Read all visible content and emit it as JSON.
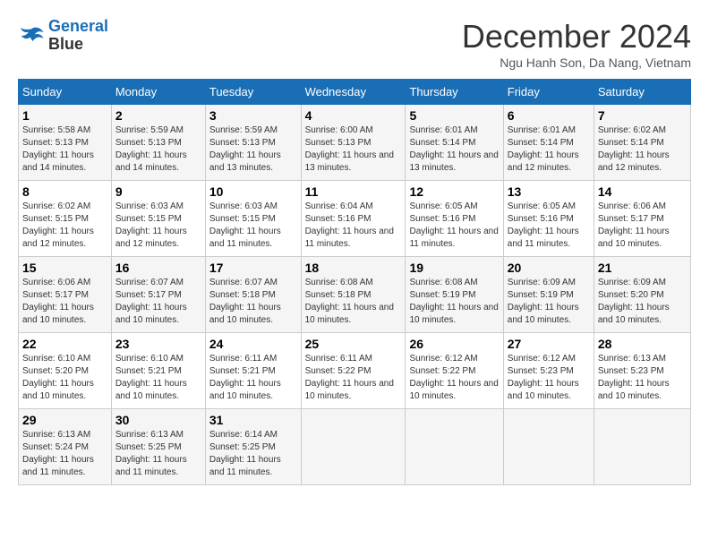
{
  "logo": {
    "line1": "General",
    "line2": "Blue"
  },
  "title": "December 2024",
  "location": "Ngu Hanh Son, Da Nang, Vietnam",
  "weekdays": [
    "Sunday",
    "Monday",
    "Tuesday",
    "Wednesday",
    "Thursday",
    "Friday",
    "Saturday"
  ],
  "weeks": [
    [
      {
        "day": "1",
        "sunrise": "5:58 AM",
        "sunset": "5:13 PM",
        "daylight": "11 hours and 14 minutes."
      },
      {
        "day": "2",
        "sunrise": "5:59 AM",
        "sunset": "5:13 PM",
        "daylight": "11 hours and 14 minutes."
      },
      {
        "day": "3",
        "sunrise": "5:59 AM",
        "sunset": "5:13 PM",
        "daylight": "11 hours and 13 minutes."
      },
      {
        "day": "4",
        "sunrise": "6:00 AM",
        "sunset": "5:13 PM",
        "daylight": "11 hours and 13 minutes."
      },
      {
        "day": "5",
        "sunrise": "6:01 AM",
        "sunset": "5:14 PM",
        "daylight": "11 hours and 13 minutes."
      },
      {
        "day": "6",
        "sunrise": "6:01 AM",
        "sunset": "5:14 PM",
        "daylight": "11 hours and 12 minutes."
      },
      {
        "day": "7",
        "sunrise": "6:02 AM",
        "sunset": "5:14 PM",
        "daylight": "11 hours and 12 minutes."
      }
    ],
    [
      {
        "day": "8",
        "sunrise": "6:02 AM",
        "sunset": "5:15 PM",
        "daylight": "11 hours and 12 minutes."
      },
      {
        "day": "9",
        "sunrise": "6:03 AM",
        "sunset": "5:15 PM",
        "daylight": "11 hours and 12 minutes."
      },
      {
        "day": "10",
        "sunrise": "6:03 AM",
        "sunset": "5:15 PM",
        "daylight": "11 hours and 11 minutes."
      },
      {
        "day": "11",
        "sunrise": "6:04 AM",
        "sunset": "5:16 PM",
        "daylight": "11 hours and 11 minutes."
      },
      {
        "day": "12",
        "sunrise": "6:05 AM",
        "sunset": "5:16 PM",
        "daylight": "11 hours and 11 minutes."
      },
      {
        "day": "13",
        "sunrise": "6:05 AM",
        "sunset": "5:16 PM",
        "daylight": "11 hours and 11 minutes."
      },
      {
        "day": "14",
        "sunrise": "6:06 AM",
        "sunset": "5:17 PM",
        "daylight": "11 hours and 10 minutes."
      }
    ],
    [
      {
        "day": "15",
        "sunrise": "6:06 AM",
        "sunset": "5:17 PM",
        "daylight": "11 hours and 10 minutes."
      },
      {
        "day": "16",
        "sunrise": "6:07 AM",
        "sunset": "5:17 PM",
        "daylight": "11 hours and 10 minutes."
      },
      {
        "day": "17",
        "sunrise": "6:07 AM",
        "sunset": "5:18 PM",
        "daylight": "11 hours and 10 minutes."
      },
      {
        "day": "18",
        "sunrise": "6:08 AM",
        "sunset": "5:18 PM",
        "daylight": "11 hours and 10 minutes."
      },
      {
        "day": "19",
        "sunrise": "6:08 AM",
        "sunset": "5:19 PM",
        "daylight": "11 hours and 10 minutes."
      },
      {
        "day": "20",
        "sunrise": "6:09 AM",
        "sunset": "5:19 PM",
        "daylight": "11 hours and 10 minutes."
      },
      {
        "day": "21",
        "sunrise": "6:09 AM",
        "sunset": "5:20 PM",
        "daylight": "11 hours and 10 minutes."
      }
    ],
    [
      {
        "day": "22",
        "sunrise": "6:10 AM",
        "sunset": "5:20 PM",
        "daylight": "11 hours and 10 minutes."
      },
      {
        "day": "23",
        "sunrise": "6:10 AM",
        "sunset": "5:21 PM",
        "daylight": "11 hours and 10 minutes."
      },
      {
        "day": "24",
        "sunrise": "6:11 AM",
        "sunset": "5:21 PM",
        "daylight": "11 hours and 10 minutes."
      },
      {
        "day": "25",
        "sunrise": "6:11 AM",
        "sunset": "5:22 PM",
        "daylight": "11 hours and 10 minutes."
      },
      {
        "day": "26",
        "sunrise": "6:12 AM",
        "sunset": "5:22 PM",
        "daylight": "11 hours and 10 minutes."
      },
      {
        "day": "27",
        "sunrise": "6:12 AM",
        "sunset": "5:23 PM",
        "daylight": "11 hours and 10 minutes."
      },
      {
        "day": "28",
        "sunrise": "6:13 AM",
        "sunset": "5:23 PM",
        "daylight": "11 hours and 10 minutes."
      }
    ],
    [
      {
        "day": "29",
        "sunrise": "6:13 AM",
        "sunset": "5:24 PM",
        "daylight": "11 hours and 11 minutes."
      },
      {
        "day": "30",
        "sunrise": "6:13 AM",
        "sunset": "5:25 PM",
        "daylight": "11 hours and 11 minutes."
      },
      {
        "day": "31",
        "sunrise": "6:14 AM",
        "sunset": "5:25 PM",
        "daylight": "11 hours and 11 minutes."
      },
      null,
      null,
      null,
      null
    ]
  ]
}
